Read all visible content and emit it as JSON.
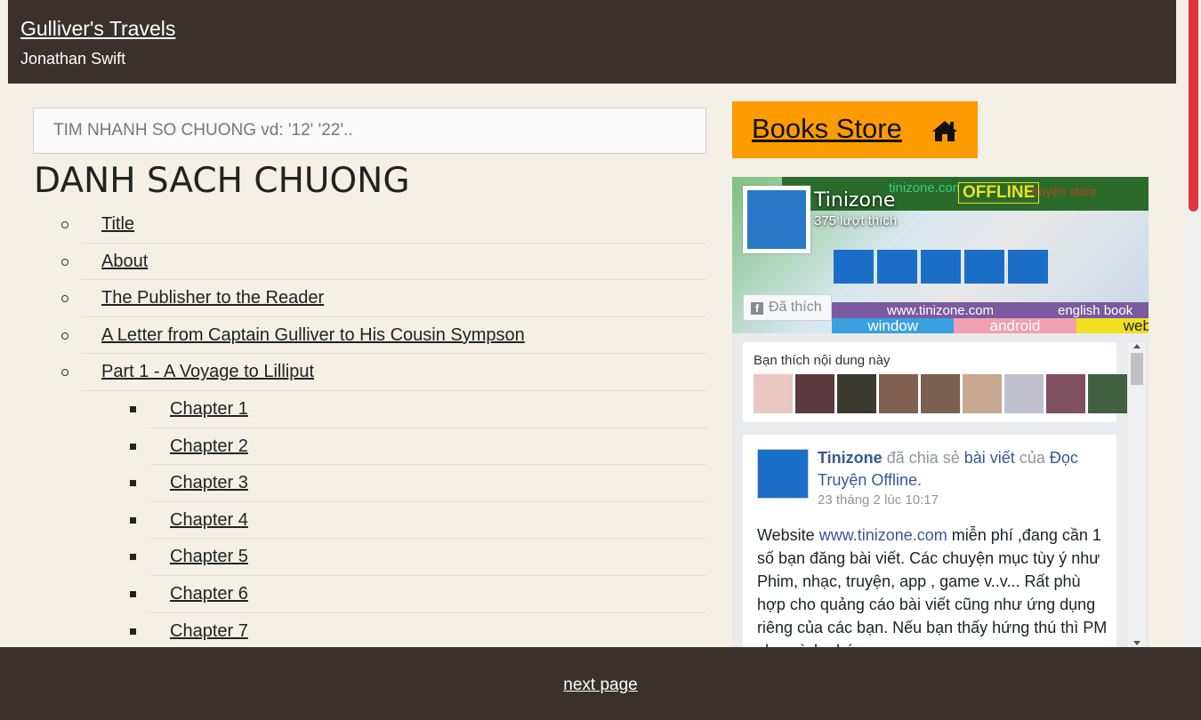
{
  "header": {
    "book_title": "Gulliver's Travels",
    "author": "Jonathan Swift"
  },
  "search": {
    "placeholder": "TIM NHANH SO CHUONG vd: '12' '22'..",
    "value": ""
  },
  "chapter_list": {
    "heading": "DANH SACH CHUONG",
    "items": [
      {
        "label": "Title",
        "level": 1
      },
      {
        "label": "About",
        "level": 1
      },
      {
        "label": "The Publisher to the Reader",
        "level": 1
      },
      {
        "label": "A Letter from Captain Gulliver to His Cousin Sympson",
        "level": 1
      },
      {
        "label": "Part 1 - A Voyage to Lilliput",
        "level": 1
      },
      {
        "label": "Chapter 1",
        "level": 2
      },
      {
        "label": "Chapter 2",
        "level": 2
      },
      {
        "label": "Chapter 3",
        "level": 2
      },
      {
        "label": "Chapter 4",
        "level": 2
      },
      {
        "label": "Chapter 5",
        "level": 2
      },
      {
        "label": "Chapter 6",
        "level": 2
      },
      {
        "label": "Chapter 7",
        "level": 2
      }
    ]
  },
  "books_store": {
    "label": "Books Store",
    "icon": "home-icon",
    "bg_color": "#fe9b00"
  },
  "facebook": {
    "page_name": "Tinizone",
    "likes": "375 lượt thích",
    "liked_button": "Đã thích",
    "cover": {
      "domain": "tinizone.com",
      "offline": "OFFLINE",
      "store": "truyện store",
      "url": "www.tinizone.com",
      "url_right": "english book",
      "tags": [
        "window",
        "android",
        "web"
      ]
    },
    "friends_label": "Bạn thích nội dung này",
    "post": {
      "author": "Tinizone",
      "shared_text": "đã chia sẻ",
      "post_link": "bài viết",
      "of_text": "của",
      "source_page": "Đọc Truyện Offline.",
      "time": "23 tháng 2 lúc 10:17",
      "body_pre": "Website ",
      "body_link": "www.tinizone.com",
      "body_post": " miễn phí ,đang cần 1 số bạn đăng bài viết. Các chuyện mục tùy ý như Phim, nhạc, truyện, app , game v..v... Rất phù hợp cho quảng cáo bài viết cũng như ứng dụng riêng của các bạn. Nếu bạn thấy hứng thú thì PM cho mình nhé"
    }
  },
  "footer": {
    "next_page": "next page"
  },
  "colors": {
    "header_bg": "#3a312c",
    "page_bg": "#f4f0e6",
    "scrollbar_thumb": "#e2343a"
  }
}
